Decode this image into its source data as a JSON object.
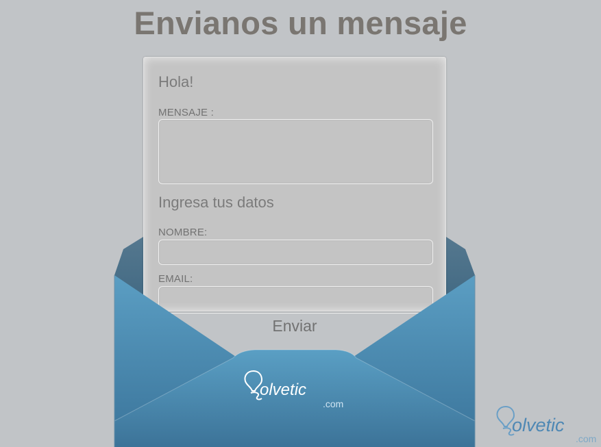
{
  "page": {
    "heading": "Envianos un mensaje"
  },
  "form": {
    "greeting": "Hola!",
    "message_label": "MENSAJE :",
    "message_value": "",
    "section_title": "Ingresa tus datos",
    "name_label": "NOMBRE:",
    "name_value": "",
    "email_label": "EMAIL:",
    "email_value": "",
    "submit_label": "Enviar"
  },
  "brand": {
    "logo_text": "olvetic",
    "logo_suffix": ".com",
    "watermark_text": "olvetic",
    "watermark_suffix": ".com"
  },
  "colors": {
    "background": "#c1c4c7",
    "envelope_blue": "#4e8fb5",
    "envelope_dark": "#3d6f8e",
    "heading": "#7a7671"
  }
}
